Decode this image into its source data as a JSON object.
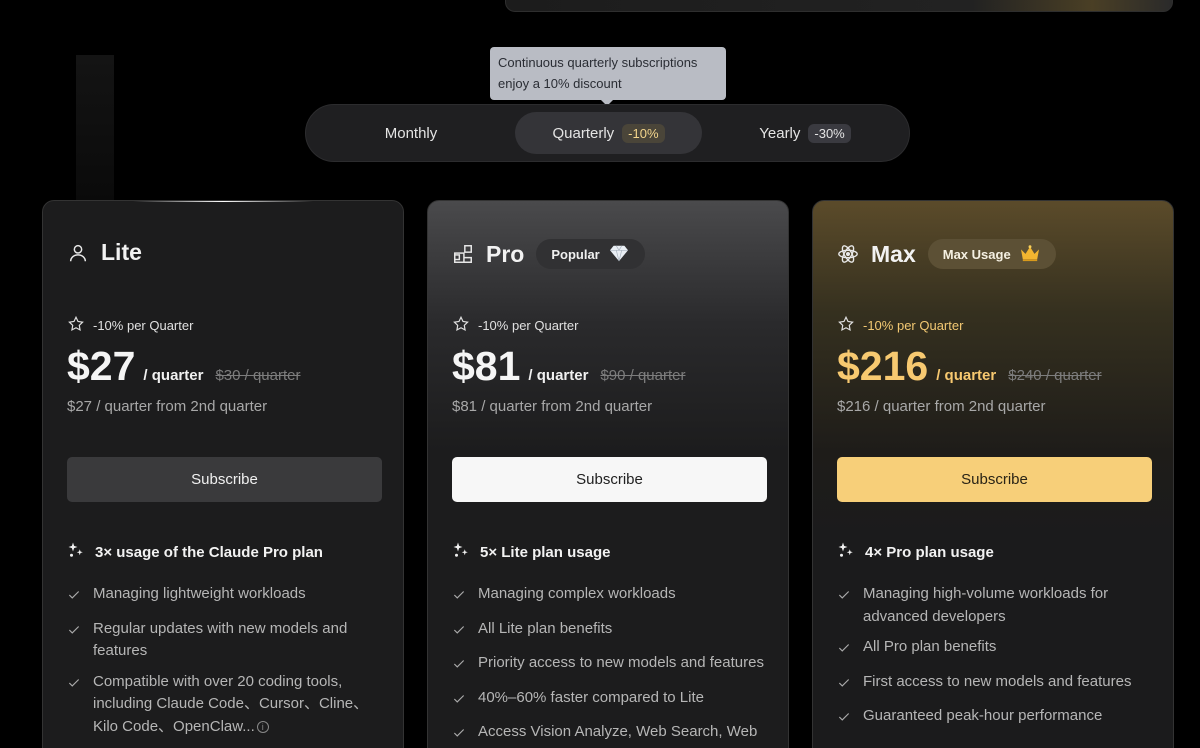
{
  "tooltip": {
    "line1": "Continuous quarterly subscriptions",
    "line2": "enjoy a 10% discount"
  },
  "billing_toggle": {
    "selected": "Quarterly",
    "options": [
      {
        "label": "Monthly",
        "discount": ""
      },
      {
        "label": "Quarterly",
        "discount": "-10%"
      },
      {
        "label": "Yearly",
        "discount": "-30%"
      }
    ]
  },
  "plans": [
    {
      "name": "Lite",
      "icon": "user-icon",
      "badge": "",
      "discount_label": "-10% per Quarter",
      "price": "$27",
      "per": "/ quarter",
      "old_price": "$30 / quarter",
      "renewal": "$27 / quarter from 2nd quarter",
      "button": "Subscribe",
      "usage": "3× usage of the Claude Pro plan",
      "features": [
        "Managing lightweight workloads",
        "Regular updates with new models and features",
        "Compatible with over 20 coding tools, including Claude Code、Cursor、Cline、Kilo Code、OpenClaw..."
      ]
    },
    {
      "name": "Pro",
      "icon": "blocks-icon",
      "badge": "Popular",
      "badge_icon": "diamond-icon",
      "discount_label": "-10% per Quarter",
      "price": "$81",
      "per": "/ quarter",
      "old_price": "$90 / quarter",
      "renewal": "$81 / quarter from 2nd quarter",
      "button": "Subscribe",
      "usage": "5× Lite plan usage",
      "features": [
        "Managing complex workloads",
        "All Lite plan benefits",
        "Priority access to new models and features",
        "40%–60% faster compared to Lite",
        "Access Vision Analyze, Web Search, Web"
      ]
    },
    {
      "name": "Max",
      "icon": "atom-icon",
      "badge": "Max Usage",
      "badge_icon": "crown-icon",
      "discount_label": "-10% per Quarter",
      "price": "$216",
      "per": "/ quarter",
      "old_price": "$240 / quarter",
      "renewal": "$216 / quarter from 2nd quarter",
      "button": "Subscribe",
      "usage": "4× Pro plan usage",
      "features": [
        "Managing high-volume workloads for advanced developers",
        "All Pro plan benefits",
        "First access to new models and features",
        "Guaranteed peak-hour performance"
      ]
    }
  ]
}
